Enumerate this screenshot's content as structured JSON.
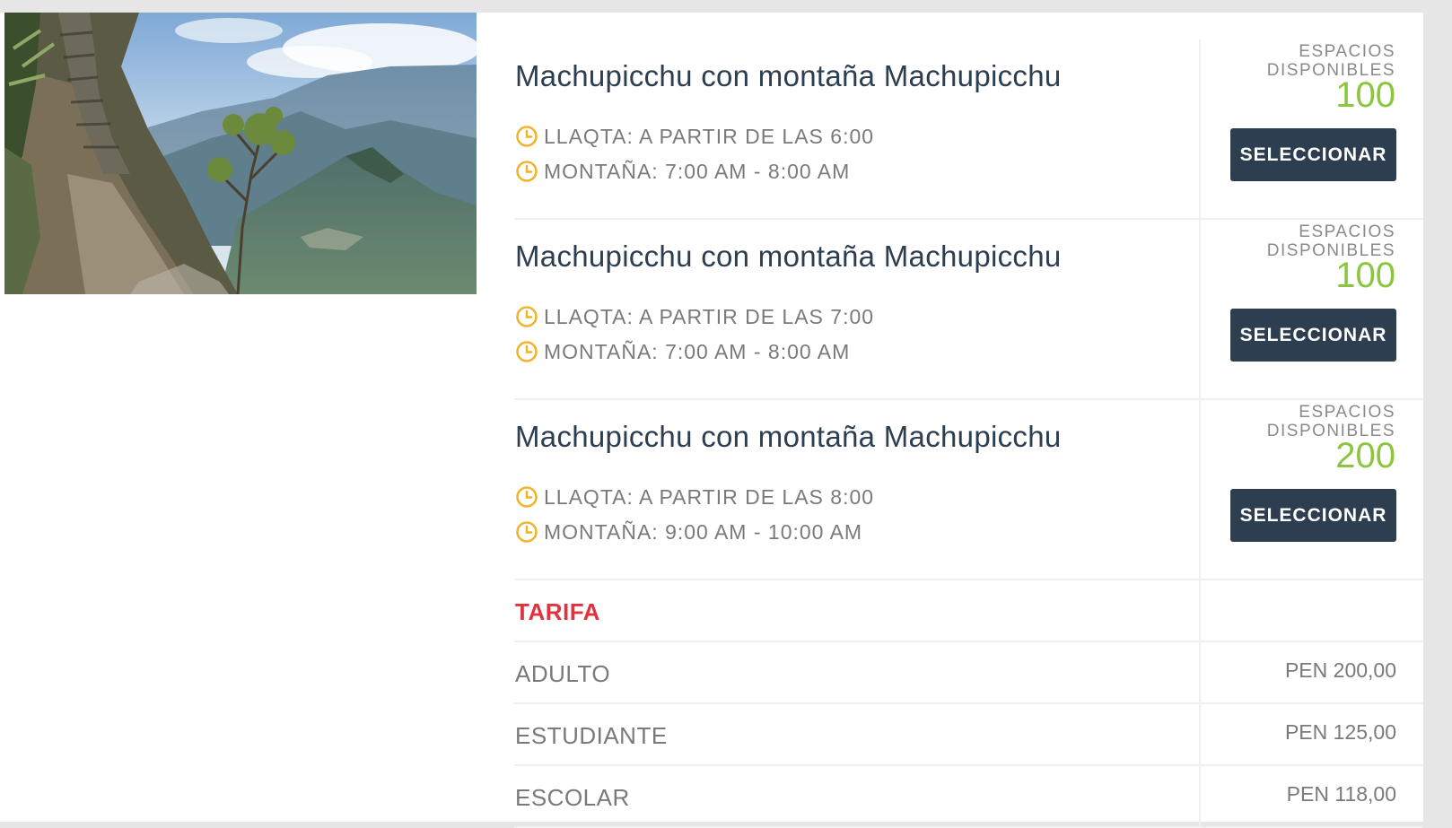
{
  "tours": [
    {
      "title": "Machupicchu con montaña Machupicchu",
      "llaqta": "LLAQTA: A PARTIR DE LAS 6:00",
      "montana": "MONTAÑA: 7:00 AM - 8:00 AM",
      "availability_label": "ESPACIOS DISPONIBLES",
      "availability_count": "100",
      "button_label": "SELECCIONAR"
    },
    {
      "title": "Machupicchu con montaña Machupicchu",
      "llaqta": "LLAQTA: A PARTIR DE LAS 7:00",
      "montana": "MONTAÑA: 7:00 AM - 8:00 AM",
      "availability_label": "ESPACIOS DISPONIBLES",
      "availability_count": "100",
      "button_label": "SELECCIONAR"
    },
    {
      "title": "Machupicchu con montaña Machupicchu",
      "llaqta": "LLAQTA: A PARTIR DE LAS 8:00",
      "montana": "MONTAÑA: 9:00 AM - 10:00 AM",
      "availability_label": "ESPACIOS DISPONIBLES",
      "availability_count": "200",
      "button_label": "SELECCIONAR"
    }
  ],
  "tarifa": {
    "title": "TARIFA",
    "rows": [
      {
        "label": "ADULTO",
        "price": "PEN 200,00"
      },
      {
        "label": "ESTUDIANTE",
        "price": "PEN 125,00"
      },
      {
        "label": "ESCOLAR",
        "price": "PEN 118,00"
      }
    ]
  },
  "icons": {
    "schedule": "clock-icon"
  },
  "colors": {
    "title_text": "#2c3e50",
    "button_bg": "#2c3e50",
    "availability_count": "#8cc63f",
    "clock_icon": "#f0b429",
    "tarifa_heading": "#e0323f",
    "muted_text": "#7a7a7a"
  }
}
